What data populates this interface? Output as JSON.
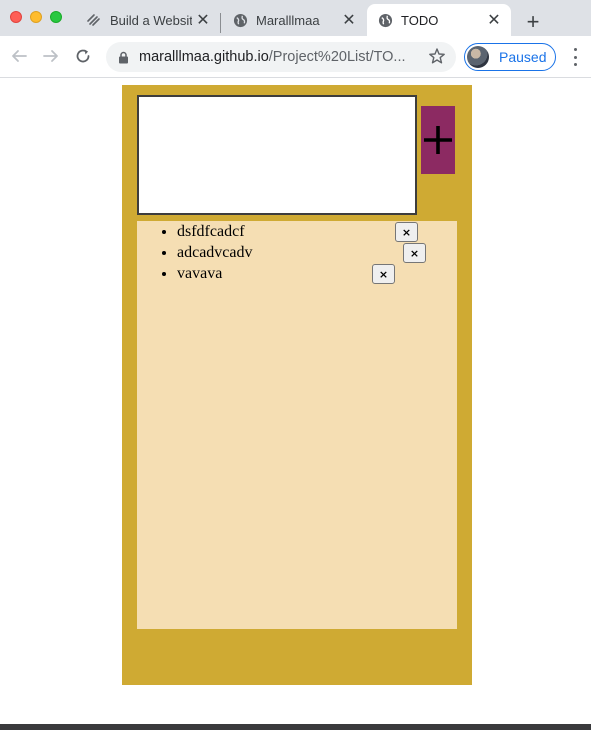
{
  "browser": {
    "tabs": [
      {
        "title": "Build a Websit",
        "icon": "squarespace-icon",
        "active": false
      },
      {
        "title": "Maralllmaa",
        "icon": "globe-icon",
        "active": false
      },
      {
        "title": "TODO",
        "icon": "globe-icon",
        "active": true
      }
    ],
    "new_tab_label": "+",
    "url_host": "maralllmaa.github.io",
    "url_path": "/Project%20List/TO...",
    "profile_label": "Paused",
    "accent_color": "#1a73e8"
  },
  "app": {
    "input_value": "",
    "add_button_label": "+",
    "todos": [
      {
        "text": "dsfdfcadcf",
        "delete_label": "×"
      },
      {
        "text": "adcadvcadv",
        "delete_label": "×"
      },
      {
        "text": "vavava",
        "delete_label": "×"
      }
    ],
    "colors": {
      "container": "#cfaa33",
      "panel": "#f5deb3",
      "add_button": "#8c2a62"
    }
  }
}
